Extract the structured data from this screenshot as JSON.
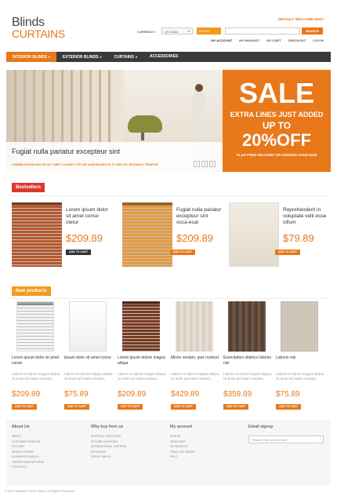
{
  "header": {
    "logo_line1": "Blinds",
    "logo_line2": "CURTAINS",
    "welcome": "DEFAULT WELCOME MSG!",
    "currency_label": "CURRENCY:",
    "currency_value": "US Dollar",
    "cart_label": "0 items",
    "search_button": "SEARCH",
    "links": [
      "MY ACCOUNT",
      "MY WISHLIST",
      "MY CART",
      "CHECKOUT",
      "LOG IN"
    ]
  },
  "nav": {
    "items": [
      {
        "label": "INTERIOR BLINDS",
        "caret": "▾"
      },
      {
        "label": "EXTERIOR BLINDS",
        "caret": "▾"
      },
      {
        "label": "CURTAINS",
        "caret": "▾"
      },
      {
        "label": "ACCESSORIES",
        "caret": ""
      }
    ]
  },
  "slider": {
    "title": "Fugiat nulla pariatur excepteur sint",
    "subtitle": "LOREM IPSUM DOLOR SIT AMET CONSE CTETUR ADIPISICING ELIT, SED DO EIUSMOD TEMPOR",
    "pages": [
      "1",
      "2",
      "3"
    ],
    "sale": {
      "line1": "SALE",
      "line2": "EXTRA LINES JUST ADDED",
      "line3": "UP TO",
      "line4": "20%OFF",
      "line5": "PLUS FREE DELIVERY ON ORDERS OVER $245"
    }
  },
  "bestsellers": {
    "label": "Bestsellers",
    "items": [
      {
        "name": "Lorem ipsum dolor sit amet conse ctetur",
        "price": "$209.89",
        "cart": "ADD TO CART"
      },
      {
        "name": "Fugiat nulla pariatur excepteur sint occa-ecat",
        "price": "$209.89",
        "cart": "ADD TO CART"
      },
      {
        "name": "Reprehenderit in voluptate velit esse cillum",
        "price": "$79.89",
        "cart": "ADD TO CART"
      }
    ]
  },
  "new_products": {
    "label": "New products",
    "items": [
      {
        "name": "Lorem ipsum dolor sit amet conse",
        "desc": "Labore et dolore magna aliqua. Ut enim ad minim veniam,",
        "price": "$209.89",
        "cart": "ADD TO CART"
      },
      {
        "name": "Ipsum dolor sit amet conse",
        "desc": "Labore et dolore magna aliqua. Ut enim ad minim veniam,",
        "price": "$75.89",
        "cart": "ADD TO CART"
      },
      {
        "name": "Lorem ipsum dolore magna aliqua",
        "desc": "Labore et dolore magna aliqua. Ut enim ad minim veniam,",
        "price": "$209.89",
        "cart": "ADD TO CART"
      },
      {
        "name": "Minim veniam, quis nostrud",
        "desc": "Labore et dolore magna aliqua. Ut enim ad minim veniam,",
        "price": "$429.89",
        "cart": "ADD TO CART"
      },
      {
        "name": "Exercitation ullamco laboris nisi",
        "desc": "Labore et dolore magna aliqua. Ut enim ad minim veniam,",
        "price": "$359.89",
        "cart": "ADD TO CART"
      },
      {
        "name": "Laboris nisi",
        "desc": "Labore et dolore magna aliqua. Ut enim ad minim veniam,",
        "price": "$75.89",
        "cart": "ADD TO CART"
      }
    ]
  },
  "footer": {
    "about": {
      "title": "About Us",
      "links": [
        "ABOUT",
        "CUSTOMER SERVICE",
        "SITE MAP",
        "SEARCH TERMS",
        "ADVANCED SEARCH",
        "ORDERS AND RETURNS",
        "CONTACTS"
      ]
    },
    "why": {
      "title": "Why buy from us",
      "links": [
        "SHIPPING & RETURNS",
        "SECURE SHOPPING",
        "INTERNATIONAL SHIPPING",
        "AFFILIATES",
        "GROUP SALES"
      ]
    },
    "account": {
      "title": "My account",
      "links": [
        "SIGN IN",
        "VIEW CART",
        "MY WISHLIST",
        "TRACK MY ORDER",
        "HELP"
      ]
    },
    "signup": {
      "title": "Email signup",
      "placeholder": "Please, enter your e-mail"
    },
    "copyright": "© 2012 Magento Demo Store. All Rights Reserved."
  },
  "colors": {
    "accent": "#e8781a",
    "bestsellers_label": "#d93a2b",
    "new_label": "#f39a1f",
    "nav": "#3a3a3a"
  }
}
